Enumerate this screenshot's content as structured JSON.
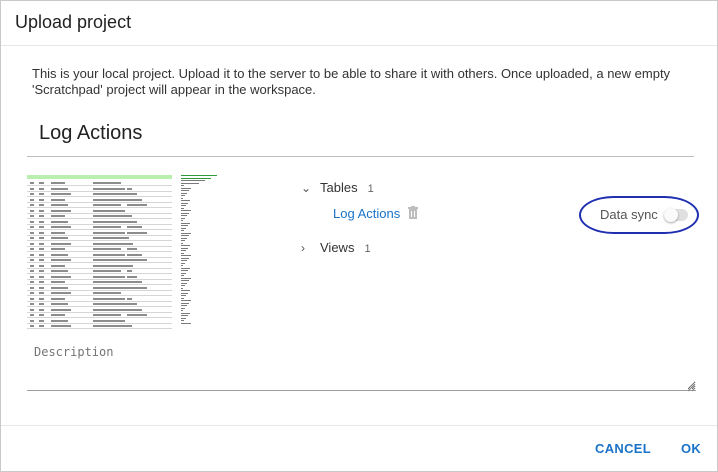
{
  "dialog": {
    "title": "Upload project",
    "description": "This is your local project. Upload it to the server to be able to share it with others. Once uploaded, a new empty 'Scratchpad' project will appear in the workspace.",
    "project_name": "Log Actions"
  },
  "tree": {
    "tables": {
      "label": "Tables",
      "count": "1",
      "items": [
        {
          "name": "Log Actions"
        }
      ]
    },
    "views": {
      "label": "Views",
      "count": "1"
    }
  },
  "data_sync": {
    "label": "Data sync",
    "enabled": false
  },
  "description_field": {
    "placeholder": "Description"
  },
  "actions": {
    "cancel": "CANCEL",
    "ok": "OK"
  },
  "colors": {
    "accent": "#1a73c8",
    "annotation": "#1f2fb0"
  }
}
